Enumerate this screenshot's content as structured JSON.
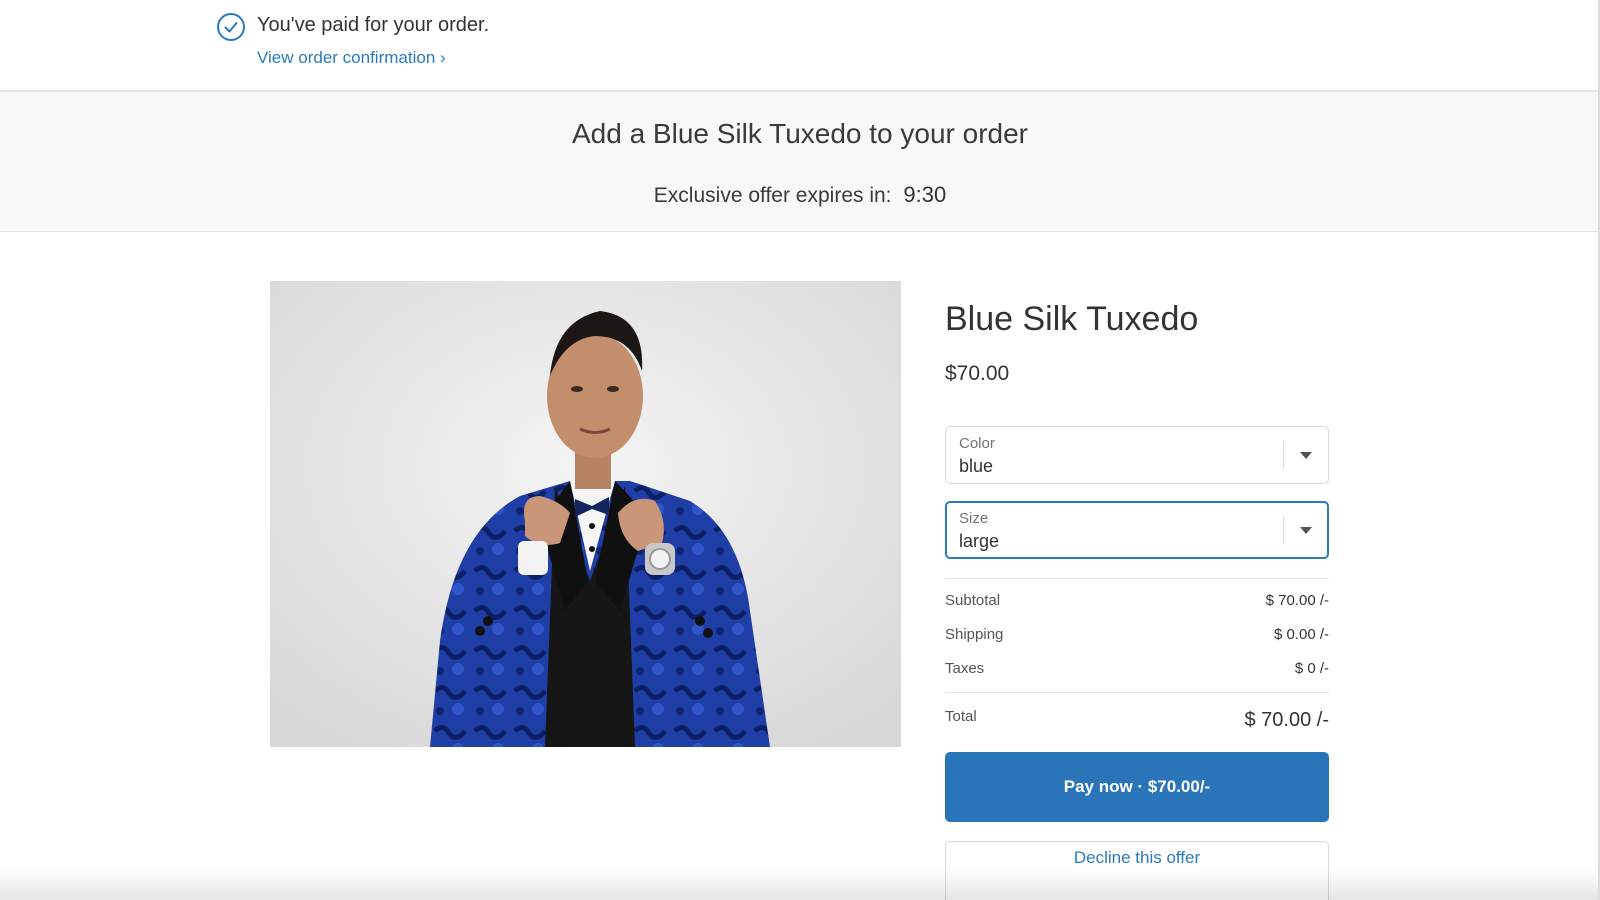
{
  "confirmation": {
    "message": "You've paid for your order.",
    "link_label": "View order confirmation ›",
    "icon": "check-circle-icon"
  },
  "offer": {
    "title": "Add a Blue Silk Tuxedo to your order",
    "expiry_label": "Exclusive offer expires in:",
    "timer": "9:30"
  },
  "product": {
    "name": "Blue Silk Tuxedo",
    "price": "$70.00",
    "image_description": "man in blue patterned silk tuxedo jacket adjusting bow tie"
  },
  "options": {
    "color": {
      "label": "Color",
      "value": "blue"
    },
    "size": {
      "label": "Size",
      "value": "large"
    }
  },
  "summary": {
    "subtotal_label": "Subtotal",
    "subtotal_value": "$ 70.00 /-",
    "shipping_label": "Shipping",
    "shipping_value": "$ 0.00 /-",
    "taxes_label": "Taxes",
    "taxes_value": "$ 0 /-",
    "total_label": "Total",
    "total_value": "$ 70.00 /-"
  },
  "actions": {
    "pay_label": "Pay now · $70.00/-",
    "decline_label": "Decline this offer"
  },
  "colors": {
    "accent": "#2a74b9",
    "link": "#2a7ac0",
    "banner_bg": "#f8f8f8",
    "border": "#d9d9d9"
  }
}
